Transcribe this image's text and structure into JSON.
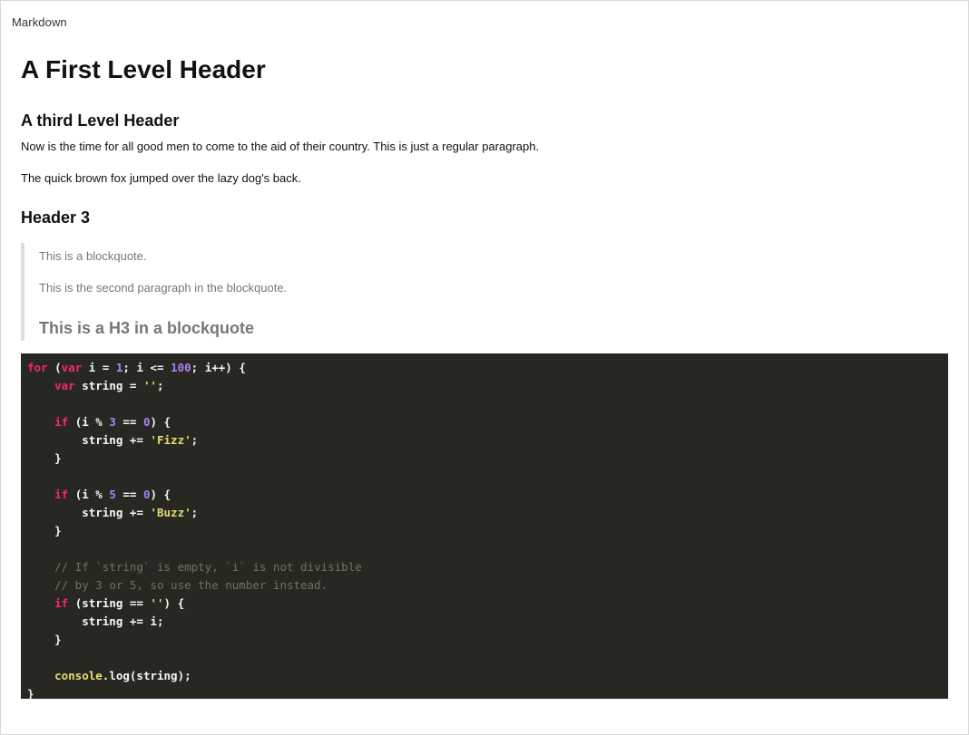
{
  "app": {
    "title": "Markdown"
  },
  "document": {
    "h1": "A First Level Header",
    "h3_a": "A third Level Header",
    "paragraph_1": "Now is the time for all good men to come to the aid of their country. This is just a regular paragraph.",
    "paragraph_2": "The quick brown fox jumped over the lazy dog's back.",
    "h3_b": "Header 3",
    "blockquote": {
      "p1": "This is a blockquote.",
      "p2": "This is the second paragraph in the blockquote.",
      "h3": "This is a H3 in a blockquote"
    }
  },
  "code": {
    "language": "javascript",
    "lines": [
      [
        {
          "t": "for",
          "c": "kw"
        },
        {
          "t": " ("
        },
        {
          "t": "var",
          "c": "kw"
        },
        {
          "t": " i = "
        },
        {
          "t": "1",
          "c": "num"
        },
        {
          "t": "; i <= "
        },
        {
          "t": "100",
          "c": "num"
        },
        {
          "t": "; i++) {"
        }
      ],
      [
        {
          "t": "    "
        },
        {
          "t": "var",
          "c": "kw"
        },
        {
          "t": " string = "
        },
        {
          "t": "''",
          "c": "str"
        },
        {
          "t": ";"
        }
      ],
      [
        {
          "t": ""
        }
      ],
      [
        {
          "t": "    "
        },
        {
          "t": "if",
          "c": "kw"
        },
        {
          "t": " (i % "
        },
        {
          "t": "3",
          "c": "num"
        },
        {
          "t": " == "
        },
        {
          "t": "0",
          "c": "num"
        },
        {
          "t": ") {"
        }
      ],
      [
        {
          "t": "        string += "
        },
        {
          "t": "'Fizz'",
          "c": "str"
        },
        {
          "t": ";"
        }
      ],
      [
        {
          "t": "    }"
        }
      ],
      [
        {
          "t": ""
        }
      ],
      [
        {
          "t": "    "
        },
        {
          "t": "if",
          "c": "kw"
        },
        {
          "t": " (i % "
        },
        {
          "t": "5",
          "c": "num"
        },
        {
          "t": " == "
        },
        {
          "t": "0",
          "c": "num"
        },
        {
          "t": ") {"
        }
      ],
      [
        {
          "t": "        string += "
        },
        {
          "t": "'Buzz'",
          "c": "str"
        },
        {
          "t": ";"
        }
      ],
      [
        {
          "t": "    }"
        }
      ],
      [
        {
          "t": ""
        }
      ],
      [
        {
          "t": "    "
        },
        {
          "t": "// If `string` is empty, `i` is not divisible",
          "c": "cm"
        }
      ],
      [
        {
          "t": "    "
        },
        {
          "t": "// by 3 or 5, so use the number instead.",
          "c": "cm"
        }
      ],
      [
        {
          "t": "    "
        },
        {
          "t": "if",
          "c": "kw"
        },
        {
          "t": " (string == "
        },
        {
          "t": "''",
          "c": "str"
        },
        {
          "t": ") {"
        }
      ],
      [
        {
          "t": "        string += i;"
        }
      ],
      [
        {
          "t": "    }"
        }
      ],
      [
        {
          "t": ""
        }
      ],
      [
        {
          "t": "    "
        },
        {
          "t": "console",
          "c": "fn"
        },
        {
          "t": ".log(string);"
        }
      ],
      [
        {
          "t": "}"
        }
      ]
    ]
  },
  "colors": {
    "code_background": "#272822",
    "code_text": "#f8f8f2",
    "keyword": "#f92672",
    "number": "#ae81ff",
    "string": "#e6db74",
    "comment": "#75715e",
    "blockquote_text": "#777777",
    "blockquote_border": "#dddddd"
  }
}
